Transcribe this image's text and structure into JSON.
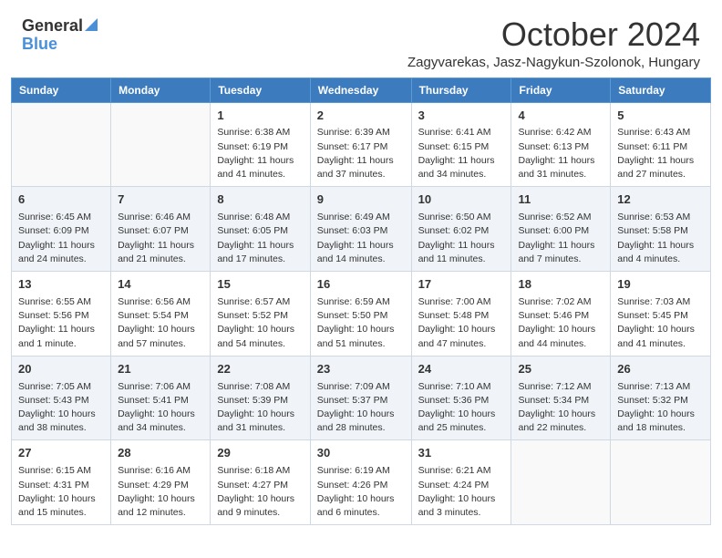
{
  "header": {
    "logo_general": "General",
    "logo_blue": "Blue",
    "title": "October 2024",
    "location": "Zagyvarekas, Jasz-Nagykun-Szolonok, Hungary"
  },
  "days_of_week": [
    "Sunday",
    "Monday",
    "Tuesday",
    "Wednesday",
    "Thursday",
    "Friday",
    "Saturday"
  ],
  "weeks": [
    [
      {
        "day": "",
        "sunrise": "",
        "sunset": "",
        "daylight": ""
      },
      {
        "day": "",
        "sunrise": "",
        "sunset": "",
        "daylight": ""
      },
      {
        "day": "1",
        "sunrise": "Sunrise: 6:38 AM",
        "sunset": "Sunset: 6:19 PM",
        "daylight": "Daylight: 11 hours and 41 minutes."
      },
      {
        "day": "2",
        "sunrise": "Sunrise: 6:39 AM",
        "sunset": "Sunset: 6:17 PM",
        "daylight": "Daylight: 11 hours and 37 minutes."
      },
      {
        "day": "3",
        "sunrise": "Sunrise: 6:41 AM",
        "sunset": "Sunset: 6:15 PM",
        "daylight": "Daylight: 11 hours and 34 minutes."
      },
      {
        "day": "4",
        "sunrise": "Sunrise: 6:42 AM",
        "sunset": "Sunset: 6:13 PM",
        "daylight": "Daylight: 11 hours and 31 minutes."
      },
      {
        "day": "5",
        "sunrise": "Sunrise: 6:43 AM",
        "sunset": "Sunset: 6:11 PM",
        "daylight": "Daylight: 11 hours and 27 minutes."
      }
    ],
    [
      {
        "day": "6",
        "sunrise": "Sunrise: 6:45 AM",
        "sunset": "Sunset: 6:09 PM",
        "daylight": "Daylight: 11 hours and 24 minutes."
      },
      {
        "day": "7",
        "sunrise": "Sunrise: 6:46 AM",
        "sunset": "Sunset: 6:07 PM",
        "daylight": "Daylight: 11 hours and 21 minutes."
      },
      {
        "day": "8",
        "sunrise": "Sunrise: 6:48 AM",
        "sunset": "Sunset: 6:05 PM",
        "daylight": "Daylight: 11 hours and 17 minutes."
      },
      {
        "day": "9",
        "sunrise": "Sunrise: 6:49 AM",
        "sunset": "Sunset: 6:03 PM",
        "daylight": "Daylight: 11 hours and 14 minutes."
      },
      {
        "day": "10",
        "sunrise": "Sunrise: 6:50 AM",
        "sunset": "Sunset: 6:02 PM",
        "daylight": "Daylight: 11 hours and 11 minutes."
      },
      {
        "day": "11",
        "sunrise": "Sunrise: 6:52 AM",
        "sunset": "Sunset: 6:00 PM",
        "daylight": "Daylight: 11 hours and 7 minutes."
      },
      {
        "day": "12",
        "sunrise": "Sunrise: 6:53 AM",
        "sunset": "Sunset: 5:58 PM",
        "daylight": "Daylight: 11 hours and 4 minutes."
      }
    ],
    [
      {
        "day": "13",
        "sunrise": "Sunrise: 6:55 AM",
        "sunset": "Sunset: 5:56 PM",
        "daylight": "Daylight: 11 hours and 1 minute."
      },
      {
        "day": "14",
        "sunrise": "Sunrise: 6:56 AM",
        "sunset": "Sunset: 5:54 PM",
        "daylight": "Daylight: 10 hours and 57 minutes."
      },
      {
        "day": "15",
        "sunrise": "Sunrise: 6:57 AM",
        "sunset": "Sunset: 5:52 PM",
        "daylight": "Daylight: 10 hours and 54 minutes."
      },
      {
        "day": "16",
        "sunrise": "Sunrise: 6:59 AM",
        "sunset": "Sunset: 5:50 PM",
        "daylight": "Daylight: 10 hours and 51 minutes."
      },
      {
        "day": "17",
        "sunrise": "Sunrise: 7:00 AM",
        "sunset": "Sunset: 5:48 PM",
        "daylight": "Daylight: 10 hours and 47 minutes."
      },
      {
        "day": "18",
        "sunrise": "Sunrise: 7:02 AM",
        "sunset": "Sunset: 5:46 PM",
        "daylight": "Daylight: 10 hours and 44 minutes."
      },
      {
        "day": "19",
        "sunrise": "Sunrise: 7:03 AM",
        "sunset": "Sunset: 5:45 PM",
        "daylight": "Daylight: 10 hours and 41 minutes."
      }
    ],
    [
      {
        "day": "20",
        "sunrise": "Sunrise: 7:05 AM",
        "sunset": "Sunset: 5:43 PM",
        "daylight": "Daylight: 10 hours and 38 minutes."
      },
      {
        "day": "21",
        "sunrise": "Sunrise: 7:06 AM",
        "sunset": "Sunset: 5:41 PM",
        "daylight": "Daylight: 10 hours and 34 minutes."
      },
      {
        "day": "22",
        "sunrise": "Sunrise: 7:08 AM",
        "sunset": "Sunset: 5:39 PM",
        "daylight": "Daylight: 10 hours and 31 minutes."
      },
      {
        "day": "23",
        "sunrise": "Sunrise: 7:09 AM",
        "sunset": "Sunset: 5:37 PM",
        "daylight": "Daylight: 10 hours and 28 minutes."
      },
      {
        "day": "24",
        "sunrise": "Sunrise: 7:10 AM",
        "sunset": "Sunset: 5:36 PM",
        "daylight": "Daylight: 10 hours and 25 minutes."
      },
      {
        "day": "25",
        "sunrise": "Sunrise: 7:12 AM",
        "sunset": "Sunset: 5:34 PM",
        "daylight": "Daylight: 10 hours and 22 minutes."
      },
      {
        "day": "26",
        "sunrise": "Sunrise: 7:13 AM",
        "sunset": "Sunset: 5:32 PM",
        "daylight": "Daylight: 10 hours and 18 minutes."
      }
    ],
    [
      {
        "day": "27",
        "sunrise": "Sunrise: 6:15 AM",
        "sunset": "Sunset: 4:31 PM",
        "daylight": "Daylight: 10 hours and 15 minutes."
      },
      {
        "day": "28",
        "sunrise": "Sunrise: 6:16 AM",
        "sunset": "Sunset: 4:29 PM",
        "daylight": "Daylight: 10 hours and 12 minutes."
      },
      {
        "day": "29",
        "sunrise": "Sunrise: 6:18 AM",
        "sunset": "Sunset: 4:27 PM",
        "daylight": "Daylight: 10 hours and 9 minutes."
      },
      {
        "day": "30",
        "sunrise": "Sunrise: 6:19 AM",
        "sunset": "Sunset: 4:26 PM",
        "daylight": "Daylight: 10 hours and 6 minutes."
      },
      {
        "day": "31",
        "sunrise": "Sunrise: 6:21 AM",
        "sunset": "Sunset: 4:24 PM",
        "daylight": "Daylight: 10 hours and 3 minutes."
      },
      {
        "day": "",
        "sunrise": "",
        "sunset": "",
        "daylight": ""
      },
      {
        "day": "",
        "sunrise": "",
        "sunset": "",
        "daylight": ""
      }
    ]
  ]
}
